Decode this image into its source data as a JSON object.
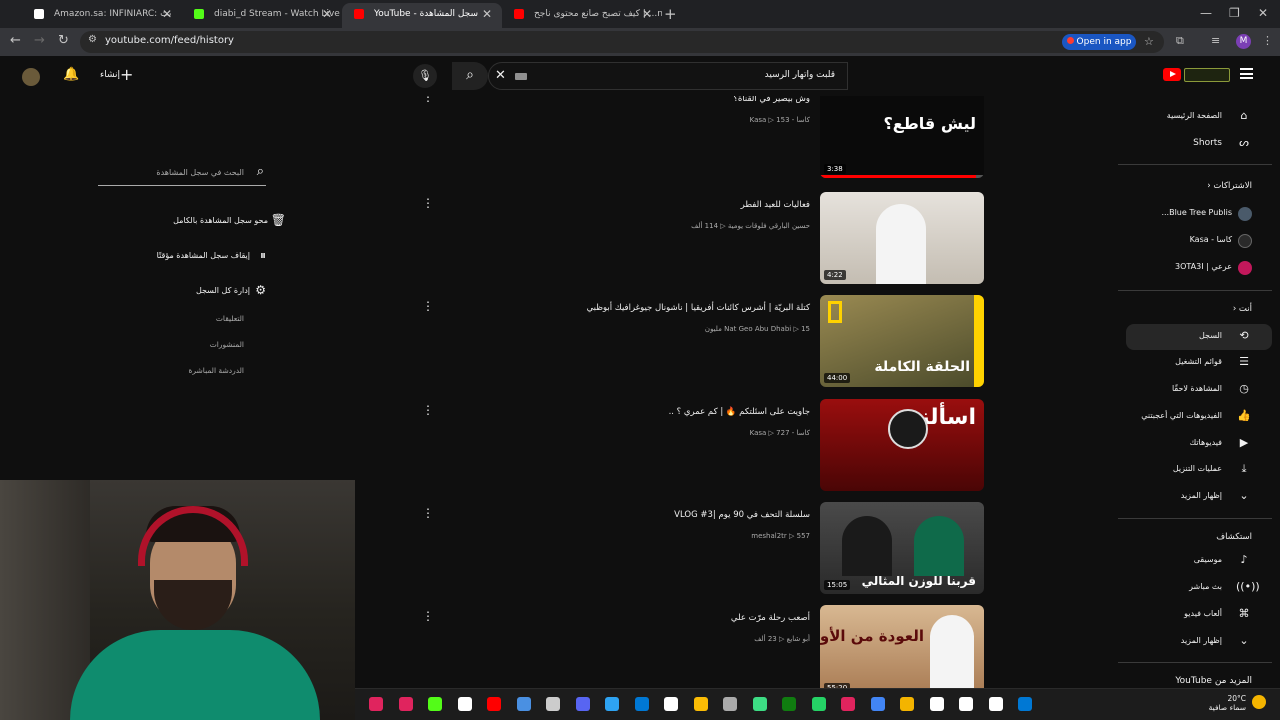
{
  "browser": {
    "tabs": [
      {
        "title": "Amazon.sa: INFINIARC: بث",
        "favicon_color": "#ffffff"
      },
      {
        "title": "diabi_d Stream - Watch Live on",
        "favicon_color": "#53fc18"
      },
      {
        "title": "YouTube - سجل المشاهدة",
        "favicon_color": "#ff0000"
      },
      {
        "title": "كيف تصبح صانع محتوى ناجح | ...ne",
        "favicon_color": "#ff0000"
      }
    ],
    "url": "youtube.com/feed/history",
    "open_in_app": "Open in app",
    "profile_initial": "M"
  },
  "header": {
    "search_query": "قلبت واتهار الرسيد",
    "create_label": "إنشاء"
  },
  "sidebar": {
    "home": "الصفحة الرئيسية",
    "shorts": "Shorts",
    "subscriptions_heading": "الاشتراكات",
    "subscriptions": [
      {
        "name": "Blue Tree Publis...",
        "avatar_color": "#4a5a6a"
      },
      {
        "name": "كاسا - Kasa",
        "avatar_color": "#2a2a2a"
      },
      {
        "name": "عرعي | 3OTA3I",
        "avatar_color": "#c2185b"
      }
    ],
    "you_heading": "أنت",
    "you_items": [
      {
        "label": "السجل",
        "icon": "history-icon"
      },
      {
        "label": "قوائم التشغيل",
        "icon": "playlists-icon"
      },
      {
        "label": "المشاهدة لاحقًا",
        "icon": "watch-later-icon"
      },
      {
        "label": "الفيديوهات التي أعجبتني",
        "icon": "like-icon"
      },
      {
        "label": "فيديوهاتك",
        "icon": "your-videos-icon"
      },
      {
        "label": "عمليات التنزيل",
        "icon": "download-icon"
      },
      {
        "label": "إظهار المزيد",
        "icon": "chevron-down-icon"
      }
    ],
    "explore_heading": "استكشاف",
    "explore_items": [
      {
        "label": "موسيقى",
        "icon": "music-icon"
      },
      {
        "label": "بث مباشر",
        "icon": "live-icon"
      },
      {
        "label": "ألعاب فيديو",
        "icon": "gaming-icon"
      },
      {
        "label": "إظهار المزيد",
        "icon": "chevron-down-icon"
      }
    ],
    "more_from": "المزيد من YouTube"
  },
  "history_panel": {
    "search_placeholder": "البحث في سجل المشاهدة",
    "clear_all": "محو سجل المشاهدة بالكامل",
    "pause": "إيقاف سجل المشاهدة مؤقتًا",
    "manage": "إدارة كل السجل",
    "links": [
      "التعليقات",
      "المنشورات",
      "الدردشة المباشرة"
    ]
  },
  "videos": [
    {
      "title": "وش بيصير في القناة؟",
      "channel": "كاسا - Kasa",
      "views": "153",
      "duration": "3:38",
      "thumb_text": "ليش قاطع؟",
      "thumb_bg": "#0a0a0a",
      "progress": 0.95
    },
    {
      "title": "فعاليات للعيد الفطر",
      "channel": "حسين البارقي فلوقات يومية",
      "views": "114 ألف",
      "duration": "4:22",
      "thumb_text": "",
      "thumb_bg": "#d9d4cc",
      "progress": 0
    },
    {
      "title": "كتلة البريّة | أشرس كائنات أفريقيا | ناشونال جيوغرافيك أبوظبي",
      "channel": "Nat Geo Abu Dhabi",
      "views": "15 مليون",
      "duration": "44:00",
      "thumb_text": "الحلقة الكاملة",
      "thumb_bg": "#7a6a3a",
      "progress": 0
    },
    {
      "title": "جاويت على اسئلتكم 🔥 | كم عمري ؟ ..",
      "channel": "كاسا - Kasa",
      "views": "727",
      "duration": "",
      "thumb_text": "اسألني",
      "thumb_bg": "#7a0a0a",
      "progress": 0
    },
    {
      "title": "سلسلة التحف في 90 يوم |VLOG #3",
      "channel": "meshal2tr",
      "views": "557",
      "duration": "15:05",
      "thumb_text": "قربنا للوزن المثالي",
      "thumb_bg": "#3a3a3a",
      "progress": 0
    },
    {
      "title": "أصعب رحلة مرّت علي",
      "channel": "أبو شايع",
      "views": "23 ألف",
      "duration": "55:20",
      "thumb_text": "العودة من الأوسكار",
      "thumb_bg": "#c9a27a",
      "progress": 0
    }
  ],
  "taskbar": {
    "icon_colors": [
      "#e0245e",
      "#e0245e",
      "#53fc18",
      "#ffffff",
      "#ff0000",
      "#4a90e2",
      "#cccccc",
      "#5865f2",
      "#2ea3f2",
      "#0078d4",
      "#ffffff",
      "#fbbc05",
      "#aaaaaa",
      "#3ddc84",
      "#107c10",
      "#25d366",
      "#e0245e",
      "#4285f4",
      "#f4b400",
      "#ffffff",
      "#ffffff",
      "#ffffff",
      "#0078d4"
    ],
    "weather_temp": "20°C",
    "weather_text": "سماء صافية"
  }
}
